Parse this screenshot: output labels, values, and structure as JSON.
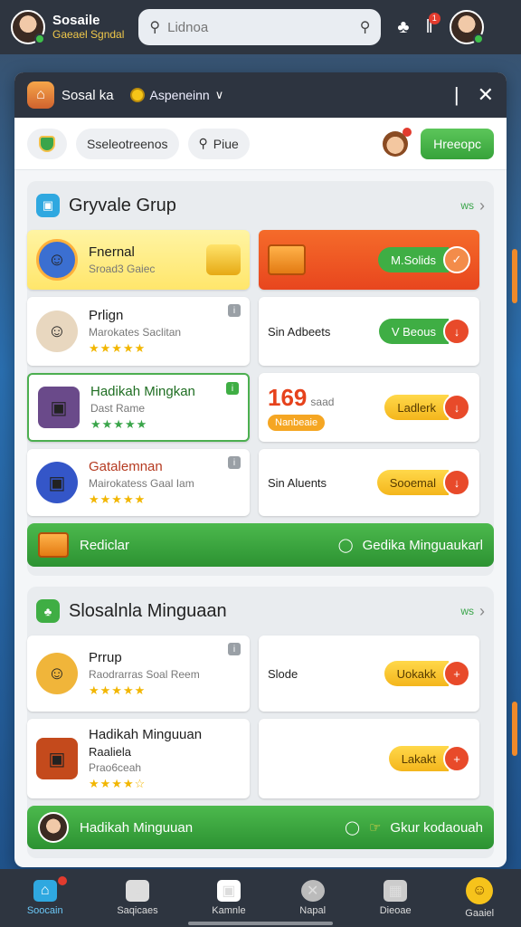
{
  "topbar": {
    "app_name": "Sosaile",
    "app_subtitle": "Gaeael Sgndal",
    "search_placeholder": "Lidnoa",
    "badge_count": "1"
  },
  "panel": {
    "title": "Sosal ka",
    "subtitle": "Aspeneinn",
    "toolbar": {
      "filter_label": "Sseleotreenos",
      "search_label": "Piue",
      "action_label": "Hreeopc"
    }
  },
  "section1": {
    "title": "Gryvale Grup",
    "more_label": "ws",
    "featured": {
      "name": "Fnernal",
      "sub": "Sroad3 Gaiec",
      "action_label": "M.Solids"
    },
    "items": [
      {
        "name": "Prlign",
        "sub": "Marokates Saclitan",
        "stars": "★★★★★",
        "right_label": "Sin Adbeets",
        "button": "V Beous"
      },
      {
        "name": "Hadikah Mingkan",
        "sub": "Dast Rame",
        "stars": "★★★★★",
        "right_num": "169",
        "right_sub": "saad",
        "right_tag": "Nanbeaie",
        "button": "Ladlerk"
      },
      {
        "name": "Gatalemnan",
        "sub": "Mairokatess Gaal Iam",
        "stars": "★★★★★",
        "right_label": "Sin Aluents",
        "button": "Sooemal"
      }
    ],
    "bar": {
      "left": "Rediclar",
      "right": "Gedika Minguaukarl"
    }
  },
  "section2": {
    "title": "Slosalnla Minguaan",
    "more_label": "ws",
    "items": [
      {
        "name": "Prrup",
        "sub": "Raodrarras Soal Reem",
        "stars": "★★★★★",
        "right_label": "Slode",
        "button": "Uokakk"
      },
      {
        "name": "Hadikah Minguuan",
        "name2": "Raaliela",
        "sub": "Prao6ceah",
        "stars": "★★★★☆",
        "right_label": "",
        "button": "Lakakt"
      }
    ],
    "bar": {
      "left": "Hadikah Minguuan",
      "right": "Gkur kodaouah"
    }
  },
  "bottomnav": [
    {
      "label": "Soocain",
      "icon": "home-icon"
    },
    {
      "label": "Saqicaes",
      "icon": "store-icon"
    },
    {
      "label": "Kamnle",
      "icon": "puzzle-icon"
    },
    {
      "label": "Napal",
      "icon": "close-circle-icon"
    },
    {
      "label": "Dieoae",
      "icon": "controller-icon"
    },
    {
      "label": "Gaaiel",
      "icon": "smile-icon"
    }
  ]
}
